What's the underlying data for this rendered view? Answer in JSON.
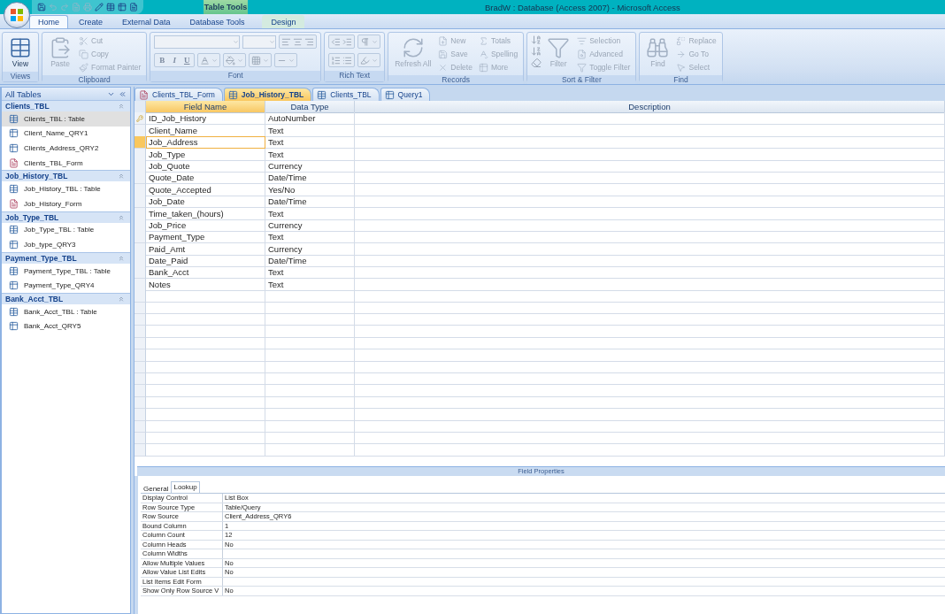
{
  "title_bar": {
    "contextual_tab": "Table Tools",
    "title": "BradW : Database (Access 2007) - Microsoft Access"
  },
  "ribbon_tabs": [
    {
      "label": "Home",
      "selected": true
    },
    {
      "label": "Create",
      "selected": false
    },
    {
      "label": "External Data",
      "selected": false
    },
    {
      "label": "Database Tools",
      "selected": false
    },
    {
      "label": "Design",
      "selected": false
    }
  ],
  "ribbon_groups": [
    {
      "label": "Views",
      "items": [
        {
          "kind": "large",
          "label": "View",
          "disabled": false
        }
      ]
    },
    {
      "label": "Clipboard",
      "items": [
        {
          "kind": "large",
          "label": "Paste",
          "disabled": true
        },
        {
          "kind": "small",
          "label": "Cut",
          "disabled": true
        },
        {
          "kind": "small",
          "label": "Copy",
          "disabled": true
        },
        {
          "kind": "small",
          "label": "Format Painter",
          "disabled": true
        }
      ]
    },
    {
      "label": "Font",
      "items": [
        {
          "kind": "format",
          "label": "B",
          "disabled": true
        },
        {
          "kind": "format",
          "label": "I",
          "disabled": true
        },
        {
          "kind": "format",
          "label": "U",
          "disabled": true
        }
      ]
    },
    {
      "label": "Rich Text"
    },
    {
      "label": "Records",
      "items": [
        {
          "kind": "large",
          "label": "Refresh All",
          "disabled": true
        },
        {
          "kind": "small",
          "label": "New",
          "disabled": true
        },
        {
          "kind": "small",
          "label": "Save",
          "disabled": true
        },
        {
          "kind": "small",
          "label": "Delete",
          "disabled": true
        },
        {
          "kind": "small",
          "label": "Totals",
          "disabled": true
        },
        {
          "kind": "small",
          "label": "Spelling",
          "disabled": true
        },
        {
          "kind": "small",
          "label": "More",
          "disabled": true
        }
      ]
    },
    {
      "label": "Sort & Filter",
      "items": [
        {
          "kind": "large",
          "label": "Filter",
          "disabled": true
        },
        {
          "kind": "small",
          "label": "Selection",
          "disabled": true
        },
        {
          "kind": "small",
          "label": "Advanced",
          "disabled": true
        },
        {
          "kind": "small",
          "label": "Toggle Filter",
          "disabled": true
        }
      ]
    },
    {
      "label": "Find",
      "items": [
        {
          "kind": "large",
          "label": "Find",
          "disabled": true
        },
        {
          "kind": "small",
          "label": "Replace",
          "disabled": true
        },
        {
          "kind": "small",
          "label": "Go To",
          "disabled": true
        },
        {
          "kind": "small",
          "label": "Select",
          "disabled": true
        }
      ]
    }
  ],
  "nav_pane": {
    "title": "All Tables",
    "groups": [
      {
        "title": "Clients_TBL",
        "expanded": true,
        "items": [
          {
            "label": "Clients_TBL : Table",
            "kind": "table",
            "selected": true
          },
          {
            "label": "Client_Name_QRY1",
            "kind": "query",
            "selected": false
          },
          {
            "label": "Clients_Address_QRY2",
            "kind": "query",
            "selected": false
          },
          {
            "label": "Clients_TBL_Form",
            "kind": "form",
            "selected": false
          }
        ]
      },
      {
        "title": "Job_History_TBL",
        "expanded": true,
        "items": [
          {
            "label": "Job_History_TBL : Table",
            "kind": "table",
            "selected": false
          },
          {
            "label": "Job_History_Form",
            "kind": "form",
            "selected": false
          }
        ]
      },
      {
        "title": "Job_Type_TBL",
        "expanded": true,
        "items": [
          {
            "label": "Job_Type_TBL : Table",
            "kind": "table",
            "selected": false
          },
          {
            "label": "Job_type_QRY3",
            "kind": "query",
            "selected": false
          }
        ]
      },
      {
        "title": "Payment_Type_TBL",
        "expanded": true,
        "items": [
          {
            "label": "Payment_Type_TBL : Table",
            "kind": "table",
            "selected": false
          },
          {
            "label": "Payment_Type_QRY4",
            "kind": "query",
            "selected": false
          }
        ]
      },
      {
        "title": "Bank_Acct_TBL",
        "expanded": true,
        "items": [
          {
            "label": "Bank_Acct_TBL : Table",
            "kind": "table",
            "selected": false
          },
          {
            "label": "Bank_Acct_QRY5",
            "kind": "query",
            "selected": false
          }
        ]
      }
    ]
  },
  "doc_tabs": [
    {
      "label": "Clients_TBL_Form",
      "kind": "form",
      "selected": false
    },
    {
      "label": "Job_History_TBL",
      "kind": "table",
      "selected": true
    },
    {
      "label": "Clients_TBL",
      "kind": "table",
      "selected": false
    },
    {
      "label": "Query1",
      "kind": "query",
      "selected": false
    }
  ],
  "design_grid": {
    "columns": [
      "Field Name",
      "Data Type",
      "Description"
    ],
    "rows": [
      {
        "field_name": "ID_Job_History",
        "data_type": "AutoNumber",
        "primary_key": true,
        "selected": false
      },
      {
        "field_name": "Client_Name",
        "data_type": "Text",
        "primary_key": false,
        "selected": false
      },
      {
        "field_name": "Job_Address",
        "data_type": "Text",
        "primary_key": false,
        "selected": true
      },
      {
        "field_name": "Job_Type",
        "data_type": "Text",
        "primary_key": false,
        "selected": false
      },
      {
        "field_name": "Job_Quote",
        "data_type": "Currency",
        "primary_key": false,
        "selected": false
      },
      {
        "field_name": "Quote_Date",
        "data_type": "Date/Time",
        "primary_key": false,
        "selected": false
      },
      {
        "field_name": "Quote_Accepted",
        "data_type": "Yes/No",
        "primary_key": false,
        "selected": false
      },
      {
        "field_name": "Job_Date",
        "data_type": "Date/Time",
        "primary_key": false,
        "selected": false
      },
      {
        "field_name": "Time_taken_(hours)",
        "data_type": "Text",
        "primary_key": false,
        "selected": false
      },
      {
        "field_name": "Job_Price",
        "data_type": "Currency",
        "primary_key": false,
        "selected": false
      },
      {
        "field_name": "Payment_Type",
        "data_type": "Text",
        "primary_key": false,
        "selected": false
      },
      {
        "field_name": "Paid_Amt",
        "data_type": "Currency",
        "primary_key": false,
        "selected": false
      },
      {
        "field_name": "Date_Paid",
        "data_type": "Date/Time",
        "primary_key": false,
        "selected": false
      },
      {
        "field_name": "Bank_Acct",
        "data_type": "Text",
        "primary_key": false,
        "selected": false
      },
      {
        "field_name": "Notes",
        "data_type": "Text",
        "primary_key": false,
        "selected": false
      }
    ]
  },
  "field_properties": {
    "title": "Field Properties",
    "tabs": [
      {
        "label": "General",
        "selected": false
      },
      {
        "label": "Lookup",
        "selected": true
      }
    ],
    "rows": [
      {
        "label": "Display Control",
        "value": "List Box"
      },
      {
        "label": "Row Source Type",
        "value": "Table/Query"
      },
      {
        "label": "Row Source",
        "value": "Client_Address_QRY6"
      },
      {
        "label": "Bound Column",
        "value": "1"
      },
      {
        "label": "Column Count",
        "value": "12"
      },
      {
        "label": "Column Heads",
        "value": "No"
      },
      {
        "label": "Column Widths"
      },
      {
        "label": "Allow Multiple Values",
        "value": "No"
      },
      {
        "label": "Allow Value List Edits",
        "value": "No"
      },
      {
        "label": "List Items Edit Form"
      },
      {
        "label": "Show Only Row Source V",
        "value": "No"
      }
    ]
  }
}
